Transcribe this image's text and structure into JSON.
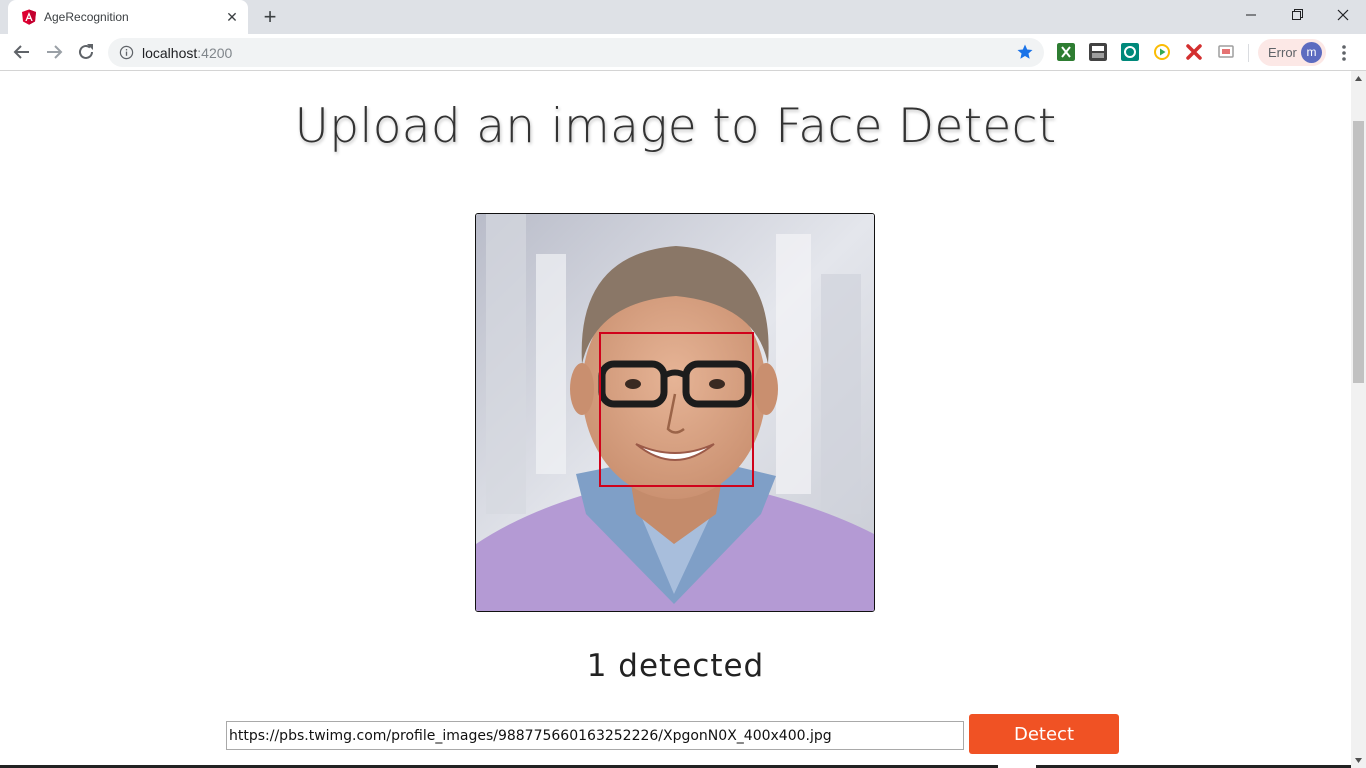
{
  "browser": {
    "tab_title": "AgeRecognition",
    "tab_close_glyph": "✕",
    "new_tab_glyph": "+",
    "url_host": "localhost",
    "url_port": ":4200",
    "profile_status": "Error",
    "profile_initial": "m",
    "icons": [
      "angular-favicon",
      "back-icon",
      "forward-icon",
      "reload-icon",
      "info-icon",
      "bookmark-star-icon",
      "kebab-menu-icon"
    ],
    "colors": {
      "accent": "#1a73e8",
      "tabstrip": "#dee1e6",
      "error_chip": "#fce8e6",
      "avatar": "#5c6bc0"
    }
  },
  "page": {
    "title": "Upload an image to Face Detect",
    "detected_text": "1 detected",
    "image_url_value": "https://pbs.twimg.com/profile_images/988775660163252226/XpgonN0X_400x400.jpg",
    "detect_button_label": "Detect",
    "colors": {
      "button": "#f05224",
      "face_box": "#d0021b",
      "heading": "#333333"
    }
  }
}
